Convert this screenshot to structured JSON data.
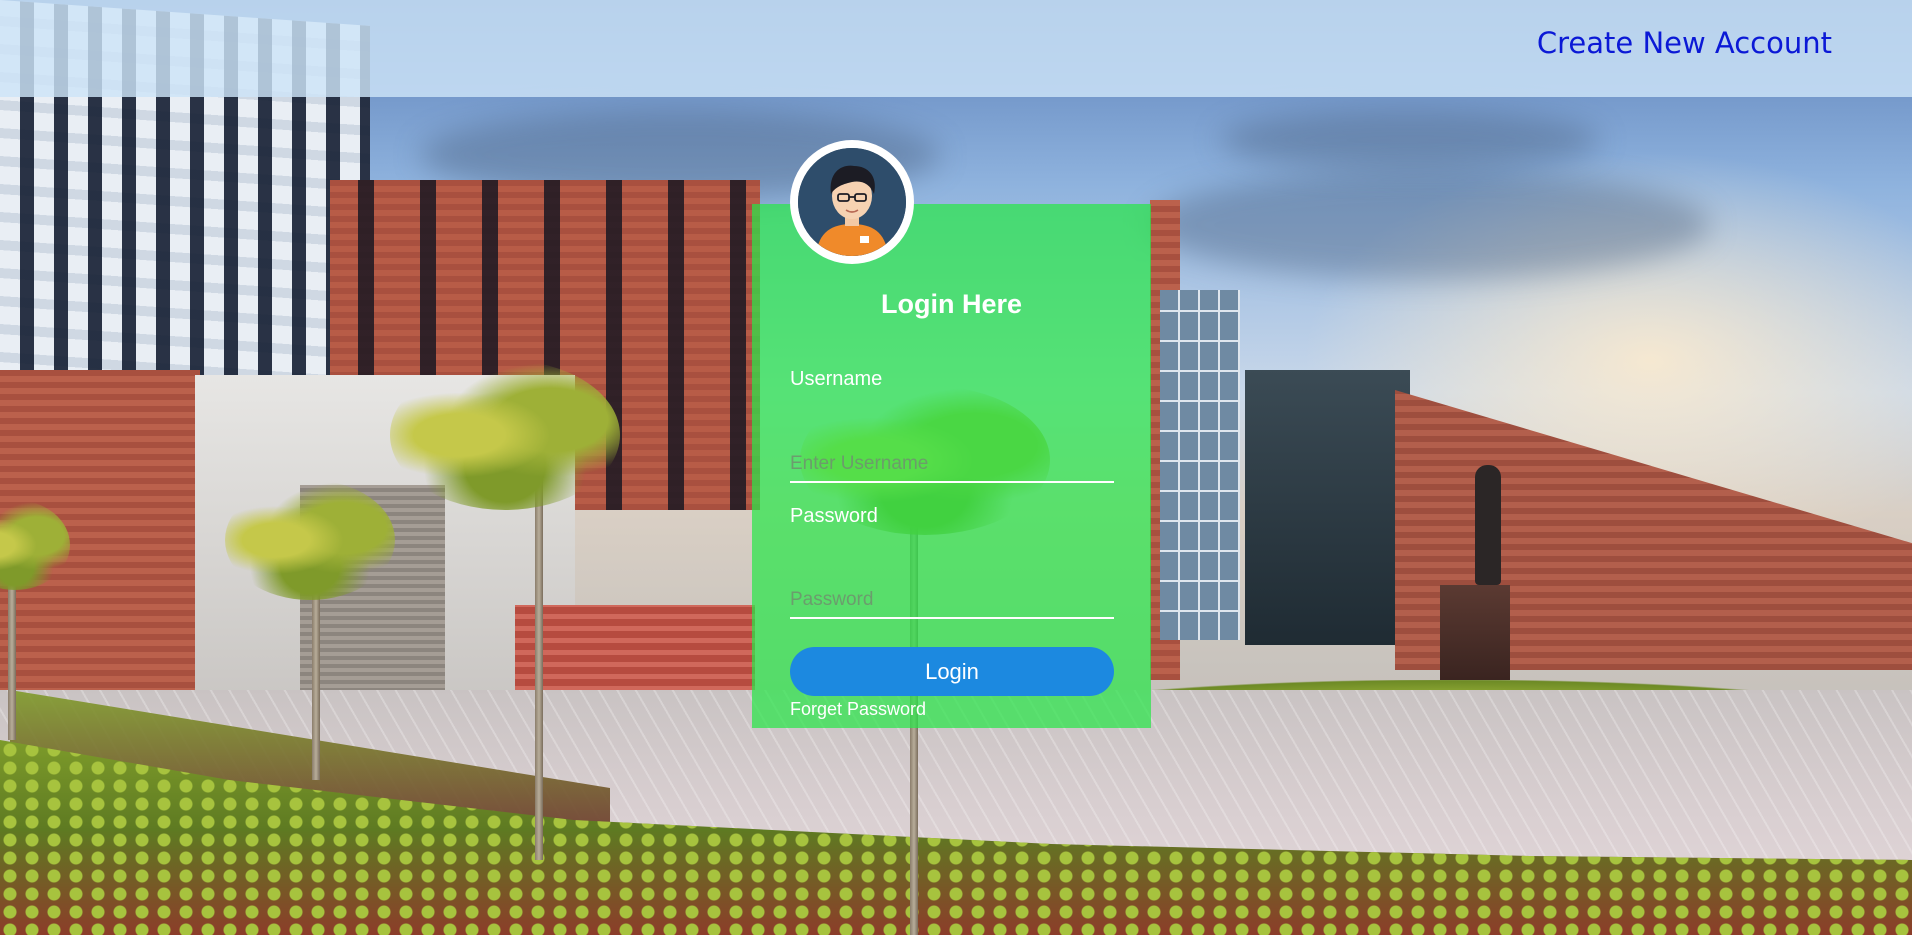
{
  "header": {
    "create_account_label": "Create New Account"
  },
  "login": {
    "title": "Login Here",
    "username": {
      "label": "Username",
      "placeholder": "Enter Username",
      "value": ""
    },
    "password": {
      "label": "Password",
      "placeholder": "Password",
      "value": ""
    },
    "submit_label": "Login",
    "forget_label": "Forget Password"
  },
  "icons": {
    "avatar": "user-avatar-icon"
  },
  "colors": {
    "panel": "#2ae64a",
    "button": "#1c89e0",
    "link": "#0b19d6"
  }
}
